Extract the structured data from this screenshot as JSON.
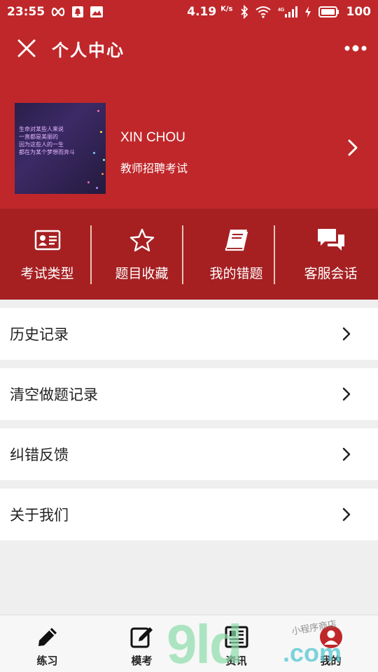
{
  "status_bar": {
    "time": "23:55",
    "speed": "4.19",
    "speed_unit": "K/s",
    "battery": "100",
    "icons": [
      "infinity-icon",
      "notification-icon",
      "image-icon",
      "bluetooth-icon",
      "vibrate-icon",
      "wifi-icon",
      "signal-icon",
      "charging-icon",
      "battery-icon"
    ]
  },
  "header": {
    "title": "个人中心",
    "close_icon": "close-icon",
    "more_icon": "more-icon"
  },
  "profile": {
    "username": "XIN CHOU",
    "subtitle": "教师招聘考试",
    "avatar_poem": [
      "生命对某些人来说",
      "一直都是美丽的",
      "因为这些人的一生",
      "都在为某个梦想而奔斗"
    ]
  },
  "quick_actions": [
    {
      "label": "考试类型",
      "icon": "id-card-icon"
    },
    {
      "label": "题目收藏",
      "icon": "star-icon"
    },
    {
      "label": "我的错题",
      "icon": "book-icon"
    },
    {
      "label": "客服会话",
      "icon": "chat-icon"
    }
  ],
  "menu": [
    {
      "label": "历史记录"
    },
    {
      "label": "清空做题记录"
    },
    {
      "label": "纠错反馈"
    },
    {
      "label": "关于我们"
    }
  ],
  "tabs": [
    {
      "label": "练习",
      "icon": "pencil-icon"
    },
    {
      "label": "模考",
      "icon": "edit-icon"
    },
    {
      "label": "资讯",
      "icon": "news-icon"
    },
    {
      "label": "我的",
      "icon": "user-icon"
    }
  ],
  "watermark": {
    "big": "9ld",
    "com": ".com",
    "small": "小程序商店"
  },
  "colors": {
    "primary": "#c0272a",
    "quick_row": "#a62022",
    "background": "#efefef"
  }
}
